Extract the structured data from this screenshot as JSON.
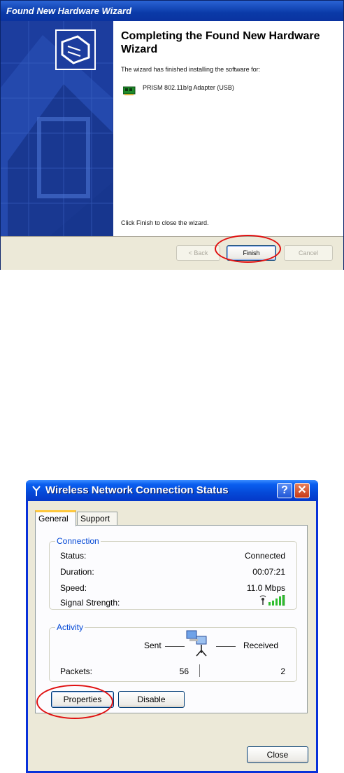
{
  "wizard": {
    "title": "Found New Hardware Wizard",
    "heading": "Completing the Found New Hardware Wizard",
    "description": "The wizard has finished installing the software for:",
    "device_name": "PRISM 802.11b/g Adapter (USB)",
    "finish_note": "Click Finish to close the wizard.",
    "buttons": {
      "back": "< Back",
      "finish": "Finish",
      "cancel": "Cancel"
    }
  },
  "status_window": {
    "title": "Wireless Network Connection Status",
    "help_button": "?",
    "close_x": "✕",
    "tabs": [
      "General",
      "Support"
    ],
    "connection": {
      "group_label": "Connection",
      "rows": [
        {
          "label": "Status:",
          "value": "Connected"
        },
        {
          "label": "Duration:",
          "value": "00:07:21"
        },
        {
          "label": "Speed:",
          "value": "11.0 Mbps"
        },
        {
          "label": "Signal Strength:",
          "value": ""
        }
      ],
      "signal_bars": 5
    },
    "activity": {
      "group_label": "Activity",
      "sent_label": "Sent",
      "received_label": "Received",
      "packets_label": "Packets:",
      "packets_sent": "56",
      "packets_received": "2"
    },
    "buttons": {
      "properties": "Properties",
      "disable": "Disable",
      "close": "Close"
    }
  },
  "colors": {
    "xp_title_blue": "#0549d8",
    "group_label_blue": "#0046d5",
    "highlight_ellipse": "#e01010",
    "signal_green": "#2fbf2f"
  }
}
